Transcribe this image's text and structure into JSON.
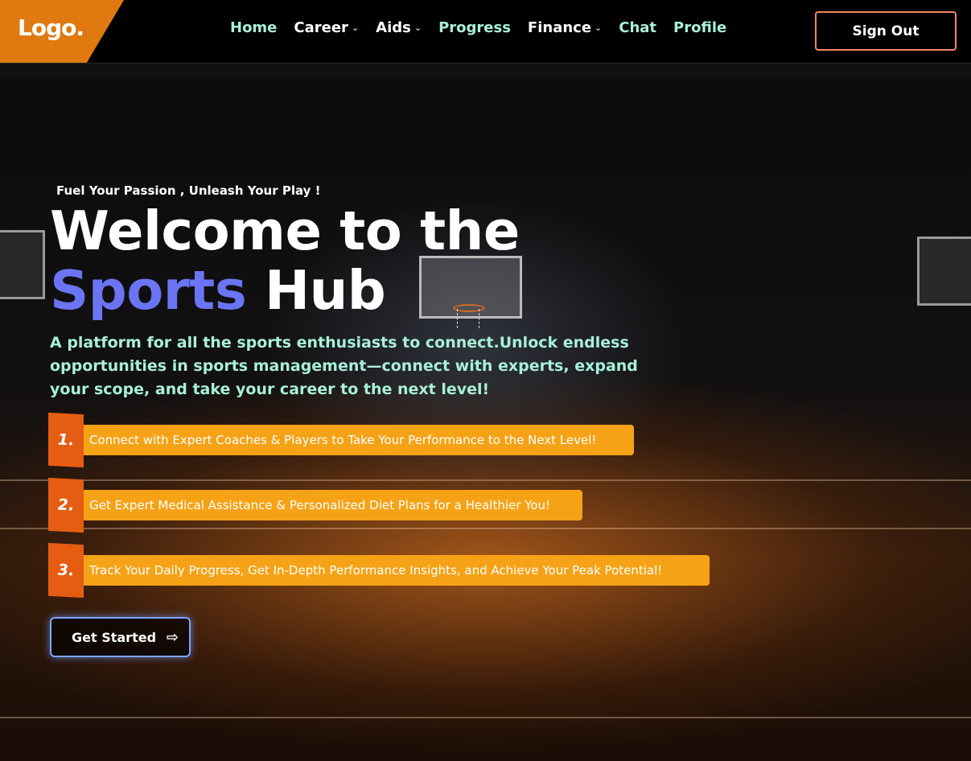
{
  "nav": {
    "logo": "Logo.",
    "items": [
      {
        "label": "Home",
        "has_dropdown": false
      },
      {
        "label": "Career",
        "has_dropdown": true
      },
      {
        "label": "Aids",
        "has_dropdown": true
      },
      {
        "label": "Progress",
        "has_dropdown": false
      },
      {
        "label": "Finance",
        "has_dropdown": true
      },
      {
        "label": "Chat",
        "has_dropdown": false
      },
      {
        "label": "Profile",
        "has_dropdown": false
      }
    ],
    "sign_out": "Sign Out"
  },
  "hero": {
    "tagline": "Fuel Your Passion , Unleash Your Play !",
    "headline_line1": "Welcome to the",
    "headline_accent": "Sports",
    "headline_end": " Hub",
    "description": "A platform for all the sports enthusiasts to connect.Unlock endless opportunities in sports management—connect with experts, expand your scope, and take your career to the next level!",
    "features": [
      {
        "number": "1.",
        "text": "Connect with Expert Coaches & Players to Take Your Performance to the Next Level!"
      },
      {
        "number": "2.",
        "text": "Get Expert Medical Assistance & Personalized Diet Plans for a Healthier You!"
      },
      {
        "number": "3.",
        "text": "Track Your Daily Progress, Get In-Depth Performance Insights, and Achieve Your Peak Potential!"
      }
    ],
    "cta": "Get Started",
    "cta_icon": "arrow-right-icon"
  },
  "colors": {
    "brand_orange": "#e07a10",
    "accent_blue": "#6b74f2",
    "mint": "#a8f0d8",
    "feature_pill": "#f5a216",
    "feature_number": "#e55d12",
    "signout_border": "#f3886a"
  }
}
